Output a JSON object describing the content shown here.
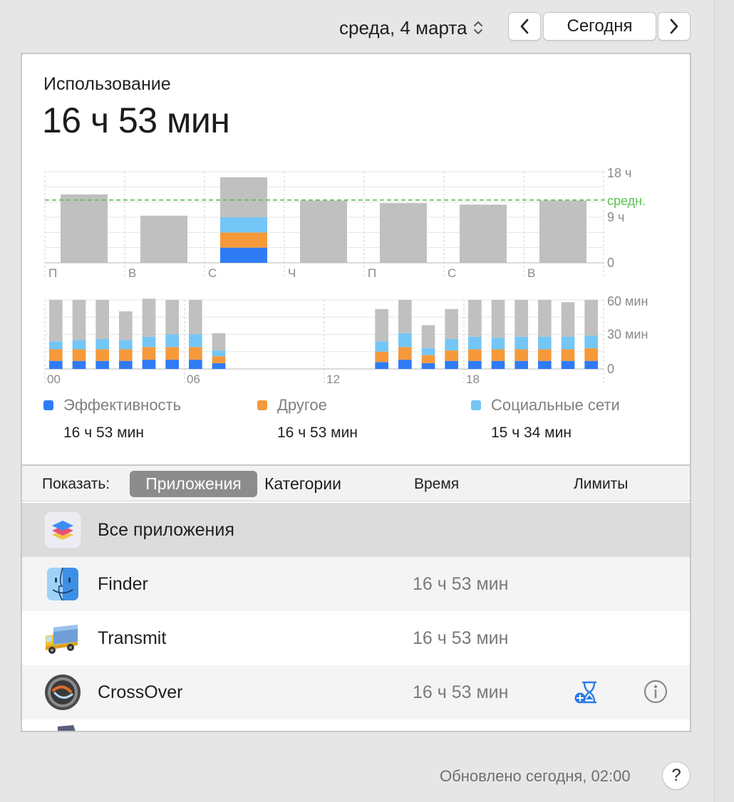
{
  "header": {
    "date_label": "среда, 4 марта",
    "today_button": "Сегодня"
  },
  "summary": {
    "label": "Использование",
    "total": "16 ч 53 мин"
  },
  "colors": {
    "productivity": "#2f7bf5",
    "other": "#f5993a",
    "social": "#74c6f7",
    "bar_gray": "#c0c0c0",
    "average_line": "#5cbf4f",
    "selected_segment": "#8c8c8c"
  },
  "chart_data": [
    {
      "type": "bar",
      "title": "",
      "categories": [
        "П",
        "В",
        "С",
        "Ч",
        "П",
        "С",
        "В"
      ],
      "series": [
        {
          "name": "Эффективность",
          "values": [
            0,
            0,
            3,
            0,
            0,
            0,
            0
          ]
        },
        {
          "name": "Другое",
          "values": [
            0,
            0,
            3,
            0,
            0,
            0,
            0
          ]
        },
        {
          "name": "Социальные сети",
          "values": [
            0,
            0,
            3,
            0,
            0,
            0,
            0
          ]
        },
        {
          "name": "",
          "values": [
            13.5,
            9.3,
            7.9,
            12.3,
            11.8,
            11.5,
            12.3
          ]
        }
      ],
      "ylim": [
        0,
        18
      ],
      "y_ticks": [
        "18 ч",
        "9 ч",
        "0"
      ],
      "average_value": 12.4,
      "average_label": "средн.",
      "selected_index": 2,
      "grid": true
    },
    {
      "type": "bar",
      "title": "",
      "x_tick_labels": [
        "00",
        "06",
        "12",
        "18"
      ],
      "hours": [
        0,
        1,
        2,
        3,
        4,
        5,
        6,
        7,
        8,
        9,
        10,
        11,
        12,
        13,
        14,
        15,
        16,
        17,
        18,
        19,
        20,
        21,
        22,
        23
      ],
      "series": [
        {
          "name": "Эффективность",
          "values": [
            7,
            7,
            7,
            7,
            8,
            8,
            8,
            5,
            0,
            0,
            0,
            0,
            0,
            0,
            6,
            8,
            5,
            7,
            7,
            7,
            7,
            7,
            7,
            7
          ]
        },
        {
          "name": "Другое",
          "values": [
            10,
            10,
            10,
            10,
            11,
            11,
            11,
            6,
            0,
            0,
            0,
            0,
            0,
            0,
            9,
            11,
            7,
            9,
            10,
            10,
            10,
            10,
            10,
            11
          ]
        },
        {
          "name": "Социальные сети",
          "values": [
            7,
            8,
            9,
            8,
            9,
            11,
            11,
            5,
            0,
            0,
            0,
            0,
            0,
            0,
            9,
            12,
            6,
            10,
            11,
            10,
            11,
            11,
            11,
            11
          ]
        },
        {
          "name": "",
          "values": [
            36,
            35,
            34,
            25,
            33,
            30,
            30,
            15,
            0,
            0,
            0,
            0,
            0,
            0,
            28,
            29,
            20,
            26,
            32,
            33,
            32,
            32,
            30,
            31
          ]
        }
      ],
      "ylim": [
        0,
        60
      ],
      "y_ticks": [
        "60 мин",
        "30 мин",
        "0"
      ],
      "grid": true
    }
  ],
  "legend": [
    {
      "name": "Эффективность",
      "value": "16 ч 53 мин",
      "color": "#2f7bf5"
    },
    {
      "name": "Другое",
      "value": "16 ч 53 мин",
      "color": "#f5993a"
    },
    {
      "name": "Социальные сети",
      "value": "15 ч 34 мин",
      "color": "#74c6f7"
    }
  ],
  "controls": {
    "show_label": "Показать:",
    "segment_apps": "Приложения",
    "segment_categories": "Категории",
    "col_time": "Время",
    "col_limits": "Лимиты"
  },
  "apps": [
    {
      "name": "Все приложения",
      "time": "",
      "icon": "all-apps-icon"
    },
    {
      "name": "Finder",
      "time": "16 ч 53 мин",
      "icon": "finder-icon"
    },
    {
      "name": "Transmit",
      "time": "16 ч 53 мин",
      "icon": "transmit-truck-icon"
    },
    {
      "name": "CrossOver",
      "time": "16 ч 53 мин",
      "icon": "crossover-icon"
    }
  ],
  "footer": {
    "updated": "Обновлено сегодня, 02:00",
    "help": "?"
  }
}
